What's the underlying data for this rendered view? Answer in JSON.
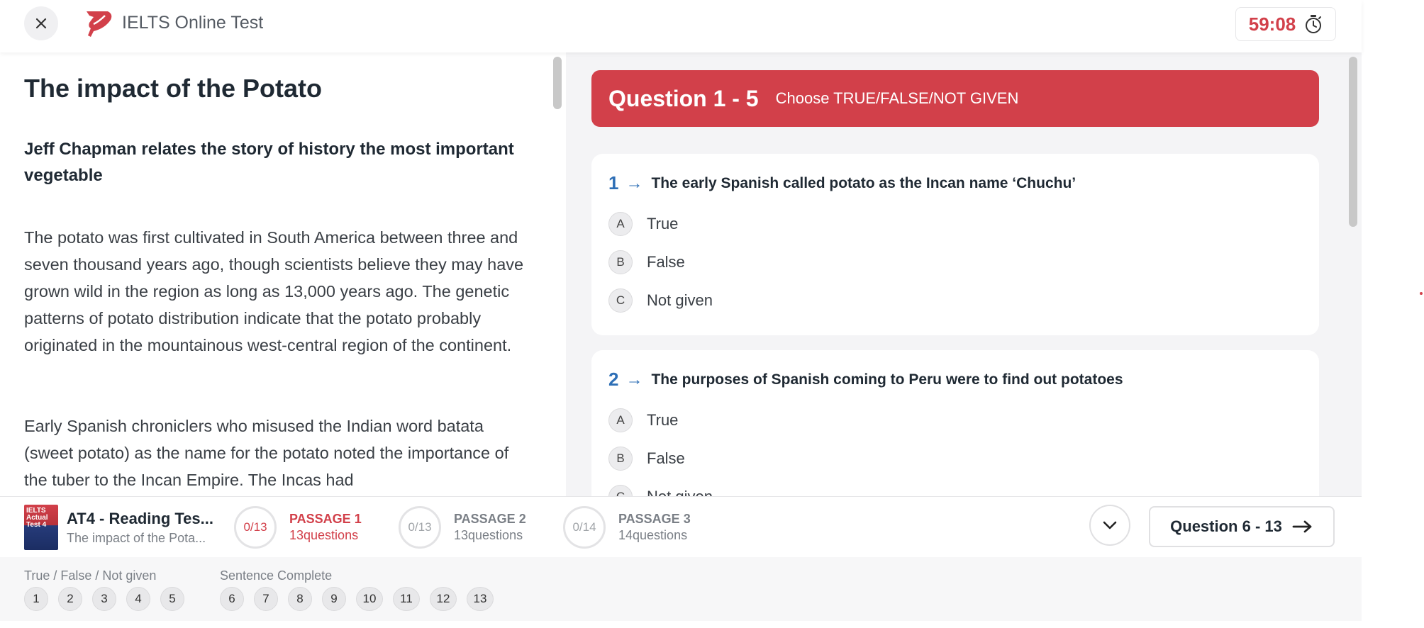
{
  "header": {
    "app_title": "IELTS Online Test",
    "timer": "59:08",
    "colors": {
      "brand": "#d2404a"
    }
  },
  "passage": {
    "title": "The impact of the Potato",
    "subtitle": "Jeff Chapman relates the story of history the most important vegetable",
    "paragraphs": [
      "The potato was first cultivated in South America between three and seven thousand years ago, though scientists believe they may have grown wild in the region as long as 13,000 years ago. The genetic patterns of potato distribution indicate that the potato probably originated in the mountainous west-central region of the continent.",
      "Early Spanish chroniclers who misused the Indian word batata (sweet potato) as the name for the potato noted the importance of the tuber to the Incan Empire. The Incas had"
    ]
  },
  "questions": {
    "range": "Question 1 - 5",
    "instruction": "Choose TRUE/FALSE/NOT GIVEN",
    "items": [
      {
        "number": "1",
        "text": "The early Spanish called potato as the Incan name ‘Chuchu’",
        "options": [
          {
            "letter": "A",
            "label": "True"
          },
          {
            "letter": "B",
            "label": "False"
          },
          {
            "letter": "C",
            "label": "Not given"
          }
        ]
      },
      {
        "number": "2",
        "text": "The purposes of Spanish coming to Peru were to find out potatoes",
        "options": [
          {
            "letter": "A",
            "label": "True"
          },
          {
            "letter": "B",
            "label": "False"
          },
          {
            "letter": "C",
            "label": "Not given"
          }
        ]
      }
    ]
  },
  "bottom_nav": {
    "thumb_text": "IELTS Actual Test 4",
    "test_title": "AT4 - Reading Tes...",
    "test_subtitle": "The impact of the Pota...",
    "passages": [
      {
        "progress": "0/13",
        "name": "PASSAGE 1",
        "count": "13questions",
        "active": true
      },
      {
        "progress": "0/13",
        "name": "PASSAGE 2",
        "count": "13questions",
        "active": false
      },
      {
        "progress": "0/14",
        "name": "PASSAGE 3",
        "count": "14questions",
        "active": false
      }
    ],
    "next_label": "Question 6 - 13"
  },
  "palette": {
    "groups": [
      {
        "label": "True / False / Not given",
        "numbers": [
          "1",
          "2",
          "3",
          "4",
          "5"
        ]
      },
      {
        "label": "Sentence Complete",
        "numbers": [
          "6",
          "7",
          "8",
          "9",
          "10",
          "11",
          "12",
          "13"
        ]
      }
    ]
  }
}
